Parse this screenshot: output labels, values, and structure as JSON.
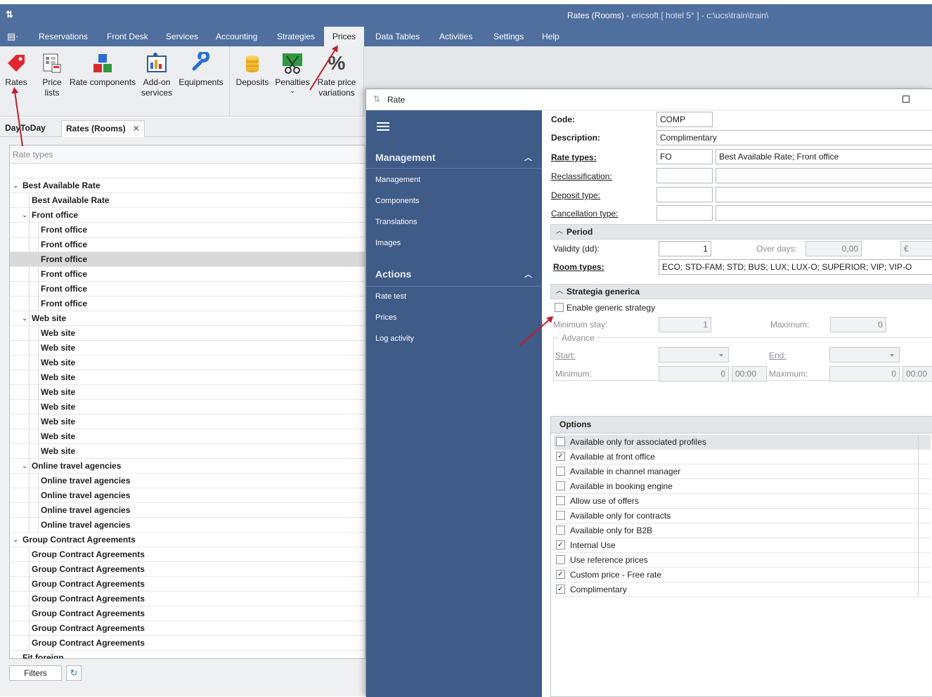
{
  "window": {
    "title": "Rates (Rooms)",
    "subtitle": " - ericsoft [ hotel 5° ] - c:\\ucs\\train\\train\\"
  },
  "menu": [
    "Reservations",
    "Front Desk",
    "Services",
    "Accounting",
    "Strategies",
    "Prices",
    "Data Tables",
    "Activities",
    "Settings",
    "Help"
  ],
  "ribbon": {
    "rates": "Rates",
    "price_lists": "Price lists",
    "rate_components": "Rate components",
    "addon_services": "Add-on services",
    "equipments": "Equipments",
    "deposits": "Deposits",
    "penalties": "Penalties",
    "rate_price_variations": "Rate price variations"
  },
  "tabs": {
    "daytoday": "DayToDay",
    "rates_rooms": "Rates (Rooms)"
  },
  "tree": {
    "header": "Rate types",
    "rows": [
      {
        "label": "",
        "level": 0,
        "group": false
      },
      {
        "label": "Best Available Rate",
        "level": 0,
        "group": true
      },
      {
        "label": "Best Available Rate",
        "level": 1,
        "group": false
      },
      {
        "label": "Front office",
        "level": 1,
        "group": true
      },
      {
        "label": "Front office",
        "level": 2,
        "group": false
      },
      {
        "label": "Front office",
        "level": 2,
        "group": false
      },
      {
        "label": "Front office",
        "level": 2,
        "group": false,
        "selected": true
      },
      {
        "label": "Front office",
        "level": 2,
        "group": false
      },
      {
        "label": "Front office",
        "level": 2,
        "group": false
      },
      {
        "label": "Front office",
        "level": 2,
        "group": false
      },
      {
        "label": "Web site",
        "level": 1,
        "group": true
      },
      {
        "label": "Web site",
        "level": 2,
        "group": false
      },
      {
        "label": "Web site",
        "level": 2,
        "group": false
      },
      {
        "label": "Web site",
        "level": 2,
        "group": false
      },
      {
        "label": "Web site",
        "level": 2,
        "group": false
      },
      {
        "label": "Web site",
        "level": 2,
        "group": false
      },
      {
        "label": "Web site",
        "level": 2,
        "group": false
      },
      {
        "label": "Web site",
        "level": 2,
        "group": false
      },
      {
        "label": "Web site",
        "level": 2,
        "group": false
      },
      {
        "label": "Web site",
        "level": 2,
        "group": false
      },
      {
        "label": "Online travel agencies",
        "level": 1,
        "group": true
      },
      {
        "label": "Online travel agencies",
        "level": 2,
        "group": false
      },
      {
        "label": "Online travel agencies",
        "level": 2,
        "group": false
      },
      {
        "label": "Online travel agencies",
        "level": 2,
        "group": false
      },
      {
        "label": "Online travel agencies",
        "level": 2,
        "group": false
      },
      {
        "label": "Group Contract Agreements",
        "level": 0,
        "group": true
      },
      {
        "label": "Group Contract Agreements",
        "level": 1,
        "group": false
      },
      {
        "label": "Group Contract Agreements",
        "level": 1,
        "group": false
      },
      {
        "label": "Group Contract Agreements",
        "level": 1,
        "group": false
      },
      {
        "label": "Group Contract Agreements",
        "level": 1,
        "group": false
      },
      {
        "label": "Group Contract Agreements",
        "level": 1,
        "group": false
      },
      {
        "label": "Group Contract Agreements",
        "level": 1,
        "group": false
      },
      {
        "label": "Group Contract Agreements",
        "level": 1,
        "group": false
      },
      {
        "label": "Fit foreign",
        "level": 0,
        "group": true
      }
    ]
  },
  "bottom": {
    "filters": "Filters"
  },
  "dialog": {
    "title": "Rate",
    "nav": {
      "management_header": "Management",
      "management_items": [
        "Management",
        "Components",
        "Translations",
        "Images"
      ],
      "actions_header": "Actions",
      "actions_items": [
        "Rate test",
        "Prices",
        "Log activity"
      ]
    },
    "form": {
      "code_label": "Code:",
      "code": "COMP",
      "description_label": "Description:",
      "description": "Complimentary",
      "rate_types_label": "Rate types:",
      "rate_types_code": "FO",
      "rate_types_desc": "Best Available Rate; Front office",
      "reclassification_label": "Reclassification:",
      "deposit_type_label": "Deposit type:",
      "cancellation_type_label": "Cancellation type:",
      "period_header": "Period",
      "validity_label": "Validity (dd):",
      "validity": "1",
      "over_days_label": "Over days:",
      "over_days": "0,00",
      "currency": "€",
      "room_types_label": "Room types:",
      "room_types": "ECO; STD-FAM; STD; BUS; LUX; LUX-O; SUPERIOR; VIP; VIP-O",
      "strategy_header": "Strategia generica",
      "enable_strategy": "Enable generic strategy",
      "min_stay_label": "Minimum stay:",
      "min_stay": "1",
      "maximum_label": "Maximum:",
      "maximum": "0",
      "advance_label": "Advance",
      "start_label": "Start:",
      "end_label": "End:",
      "adv_min_label": "Minimum:",
      "adv_min": "0",
      "adv_min_time": "00:00",
      "adv_max_label": "Maximum:",
      "adv_max": "0",
      "adv_max_time": "00:00"
    },
    "options": {
      "header": "Options",
      "items": [
        {
          "label": "Available only for associated profiles",
          "checked": false
        },
        {
          "label": "Available at front office",
          "checked": true
        },
        {
          "label": "Available in channel manager",
          "checked": false
        },
        {
          "label": "Available in booking engine",
          "checked": false
        },
        {
          "label": "Allow use of offers",
          "checked": false
        },
        {
          "label": "Available only for contracts",
          "checked": false
        },
        {
          "label": "Available only for B2B",
          "checked": false
        },
        {
          "label": "Internal Use",
          "checked": true
        },
        {
          "label": "Use reference prices",
          "checked": false
        },
        {
          "label": "Custom price - Free rate",
          "checked": true
        },
        {
          "label": "Complimentary",
          "checked": true
        }
      ]
    }
  },
  "colors": {
    "accent": "#4f6f9f",
    "nav": "#3f5b87",
    "annotation": "#c0202a"
  }
}
